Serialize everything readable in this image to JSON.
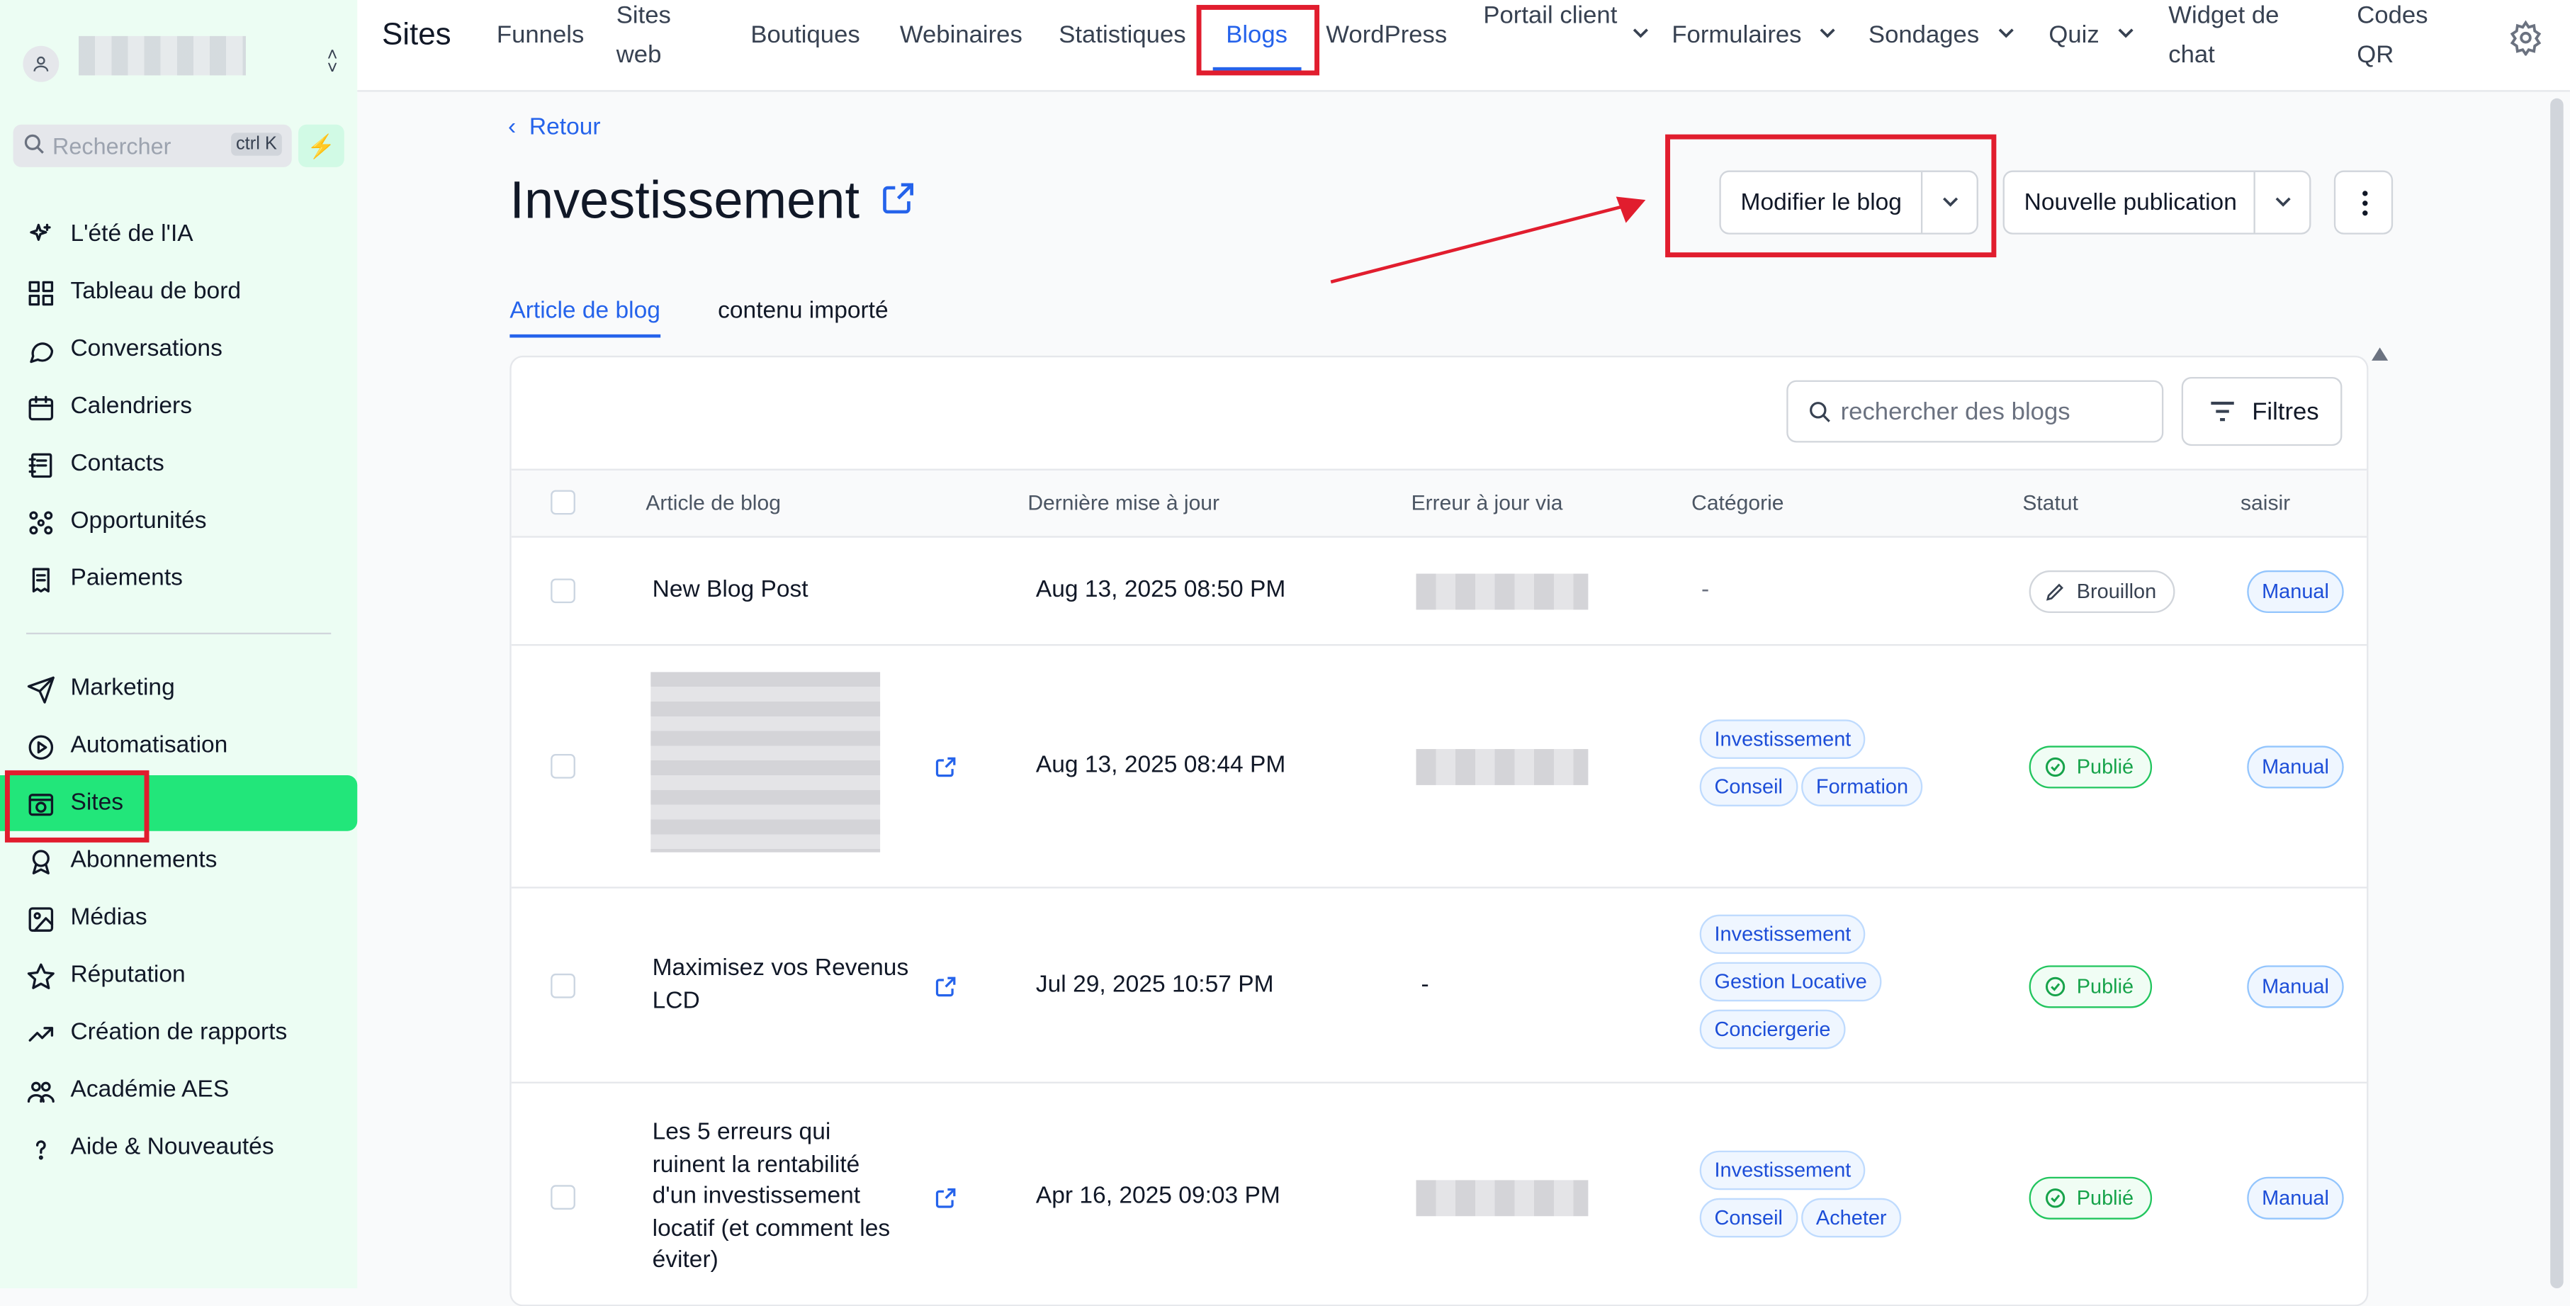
{
  "sidebar": {
    "search_placeholder": "Rechercher",
    "search_shortcut": "ctrl K",
    "items": [
      {
        "label": "L'été de l'IA",
        "icon": "sparkle-icon"
      },
      {
        "label": "Tableau de bord",
        "icon": "dashboard-icon"
      },
      {
        "label": "Conversations",
        "icon": "chat-bubble-icon"
      },
      {
        "label": "Calendriers",
        "icon": "calendar-icon"
      },
      {
        "label": "Contacts",
        "icon": "contact-book-icon"
      },
      {
        "label": "Opportunités",
        "icon": "pipeline-icon"
      },
      {
        "label": "Paiements",
        "icon": "receipt-icon"
      },
      {
        "label": "Marketing",
        "icon": "send-icon"
      },
      {
        "label": "Automatisation",
        "icon": "automation-icon"
      },
      {
        "label": "Sites",
        "icon": "globe-window-icon",
        "active": true
      },
      {
        "label": "Abonnements",
        "icon": "badge-icon"
      },
      {
        "label": "Médias",
        "icon": "image-icon"
      },
      {
        "label": "Réputation",
        "icon": "star-icon"
      },
      {
        "label": "Création de rapports",
        "icon": "trend-icon"
      },
      {
        "label": "Académie AES",
        "icon": "users-icon"
      },
      {
        "label": "Aide & Nouveautés",
        "icon": "question-icon"
      }
    ]
  },
  "topbar": {
    "title": "Sites",
    "nav": [
      {
        "label": "Funnels"
      },
      {
        "label": "Sites web"
      },
      {
        "label": "Boutiques"
      },
      {
        "label": "Webinaires"
      },
      {
        "label": "Statistiques"
      },
      {
        "label": "Blogs",
        "active": true
      },
      {
        "label": "WordPress"
      },
      {
        "label": "Portail client",
        "dropdown": true
      },
      {
        "label": "Formulaires",
        "dropdown": true
      },
      {
        "label": "Sondages",
        "dropdown": true
      },
      {
        "label": "Quiz",
        "dropdown": true
      },
      {
        "label": "Widget de chat"
      },
      {
        "label": "Codes QR"
      }
    ]
  },
  "page": {
    "back_label": "Retour",
    "title": "Investissement",
    "edit_blog_label": "Modifier le blog",
    "new_post_label": "Nouvelle publication",
    "tabs": [
      {
        "label": "Article de blog",
        "active": true
      },
      {
        "label": "contenu importé"
      }
    ],
    "search_placeholder": "rechercher des blogs",
    "filters_label": "Filtres"
  },
  "table": {
    "headers": [
      "Article de blog",
      "Dernière mise à jour",
      "Erreur à jour via",
      "Catégorie",
      "Statut",
      "saisir"
    ],
    "rows": [
      {
        "title_lines": [
          "New Blog Post"
        ],
        "updated": "Aug 13, 2025 08:50 PM",
        "via": "",
        "categories": [
          "-"
        ],
        "status": "Brouillon",
        "input": "Manual"
      },
      {
        "title_lines": [],
        "updated": "Aug 13, 2025 08:44 PM",
        "via": "",
        "categories": [
          "Investissement",
          "Conseil",
          "Formation"
        ],
        "status": "Publié",
        "input": "Manual"
      },
      {
        "title_lines": [
          "Maximisez vos Revenus",
          "LCD"
        ],
        "updated": "Jul 29, 2025 10:57 PM",
        "via": "-",
        "categories": [
          "Investissement",
          "Gestion Locative",
          "Conciergerie"
        ],
        "status": "Publié",
        "input": "Manual"
      },
      {
        "title_lines": [
          "Les 5 erreurs qui",
          "ruinent la rentabilité",
          "d'un investissement",
          "locatif (et comment les",
          "éviter)"
        ],
        "updated": "Apr 16, 2025 09:03 PM",
        "via": "",
        "categories": [
          "Investissement",
          "Conseil",
          "Acheter"
        ],
        "status": "Publié",
        "input": "Manual"
      }
    ]
  },
  "colors": {
    "accent": "#2563eb",
    "sidebar_bg": "#ecfdf3",
    "active_green": "#22e67a",
    "annotation_red": "#e11d2e",
    "published_green": "#16a34a"
  }
}
